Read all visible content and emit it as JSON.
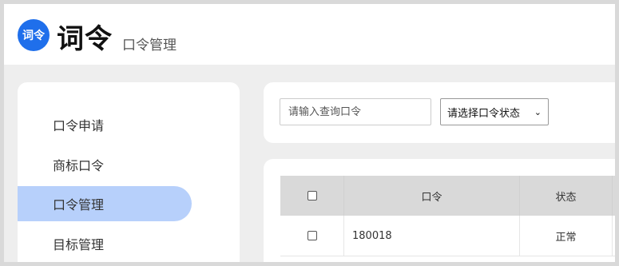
{
  "header": {
    "logo_text": "词令",
    "app_name": "词令",
    "page_subtitle": "口令管理"
  },
  "sidebar": {
    "items": [
      {
        "label": "口令申请",
        "active": false
      },
      {
        "label": "商标口令",
        "active": false
      },
      {
        "label": "口令管理",
        "active": true
      },
      {
        "label": "目标管理",
        "active": false
      }
    ]
  },
  "filters": {
    "search_placeholder": "请输入查询口令",
    "search_value": "",
    "status_select_value": "请选择口令状态"
  },
  "table": {
    "columns": [
      "",
      "口令",
      "状态"
    ],
    "rows": [
      {
        "checked": false,
        "code": "180018",
        "status": "正常"
      }
    ]
  },
  "colors": {
    "accent": "#1f6feb",
    "active_nav_bg": "#b7d0fb",
    "table_header_bg": "#d9d9d9",
    "page_bg": "#eeeeee"
  },
  "icons": {
    "logo": "brand-logo-icon",
    "select_arrow": "chevron-down-icon"
  }
}
